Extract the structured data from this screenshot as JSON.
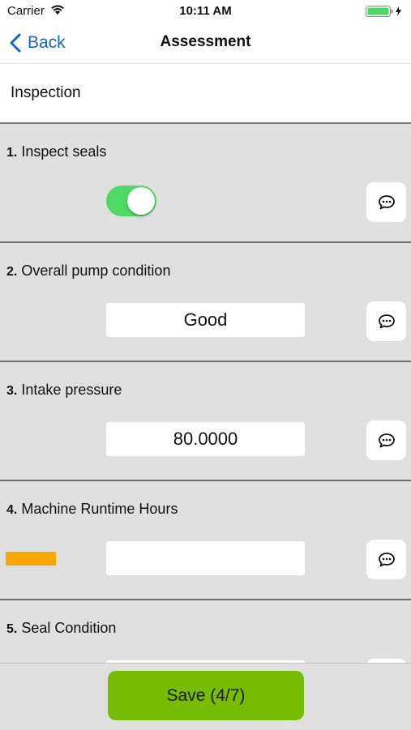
{
  "status_bar": {
    "carrier": "Carrier",
    "time": "10:11 AM",
    "battery_color": "#4cd964"
  },
  "nav": {
    "back_label": "Back",
    "title": "Assessment"
  },
  "section": {
    "title": "Inspection"
  },
  "questions": [
    {
      "number": "1.",
      "text": "Inspect seals",
      "control": "toggle",
      "value_on": true
    },
    {
      "number": "2.",
      "text": "Overall pump condition",
      "control": "field",
      "value": "Good"
    },
    {
      "number": "3.",
      "text": "Intake pressure",
      "control": "field",
      "value": "80.0000"
    },
    {
      "number": "4.",
      "text": "Machine Runtime Hours",
      "control": "field",
      "value": "",
      "required_indicator_color": "#f7a900"
    },
    {
      "number": "5.",
      "text": "Seal Condition",
      "control": "field",
      "value": ""
    }
  ],
  "comment_icon": "chat-bubble-icon",
  "footer": {
    "save_label": "Save (4/7)",
    "save_color": "#76bc00"
  }
}
